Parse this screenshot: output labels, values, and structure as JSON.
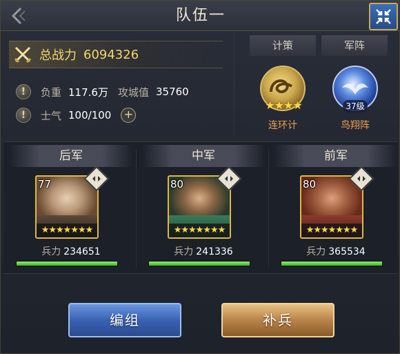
{
  "header": {
    "title": "队伍一"
  },
  "stats": {
    "power_label": "总战力",
    "power_value": "6094326",
    "load_label": "负重",
    "load_value": "117.6万",
    "siege_label": "攻城值",
    "siege_value": "35760",
    "morale_label": "士气",
    "morale_value": "100/100",
    "plus_symbol": "+",
    "warn_symbol": "!"
  },
  "side": {
    "strategy_tab": "计策",
    "formation_tab": "军阵",
    "strategy_name": "连环计",
    "strategy_stars": "★★★★",
    "formation_name": "鸟翔阵",
    "formation_level": "37级"
  },
  "army": [
    {
      "title": "后军",
      "level": "77",
      "stars": "★★★★★★★",
      "troop_label": "兵力",
      "troops": "234651",
      "troop_fraction": 1.0
    },
    {
      "title": "中军",
      "level": "80",
      "stars": "★★★★★★★",
      "troop_label": "兵力",
      "troops": "241336",
      "troop_fraction": 1.0
    },
    {
      "title": "前军",
      "level": "80",
      "stars": "★★★★★★★",
      "troop_label": "兵力",
      "troops": "365534",
      "troop_fraction": 1.0
    }
  ],
  "buttons": {
    "edit": "编组",
    "replenish": "补兵"
  },
  "colors": {
    "power": "#f4d66a",
    "accent_gold": "#e0b84a",
    "troop_bar": "#6ad84a",
    "emblem_name": "#f0a050"
  },
  "icons": {
    "back": "chevron-left-icon",
    "close": "collapse-icon",
    "power": "crossed-swords-icon",
    "warn": "exclamation-icon",
    "swap": "swap-arrows-icon"
  }
}
